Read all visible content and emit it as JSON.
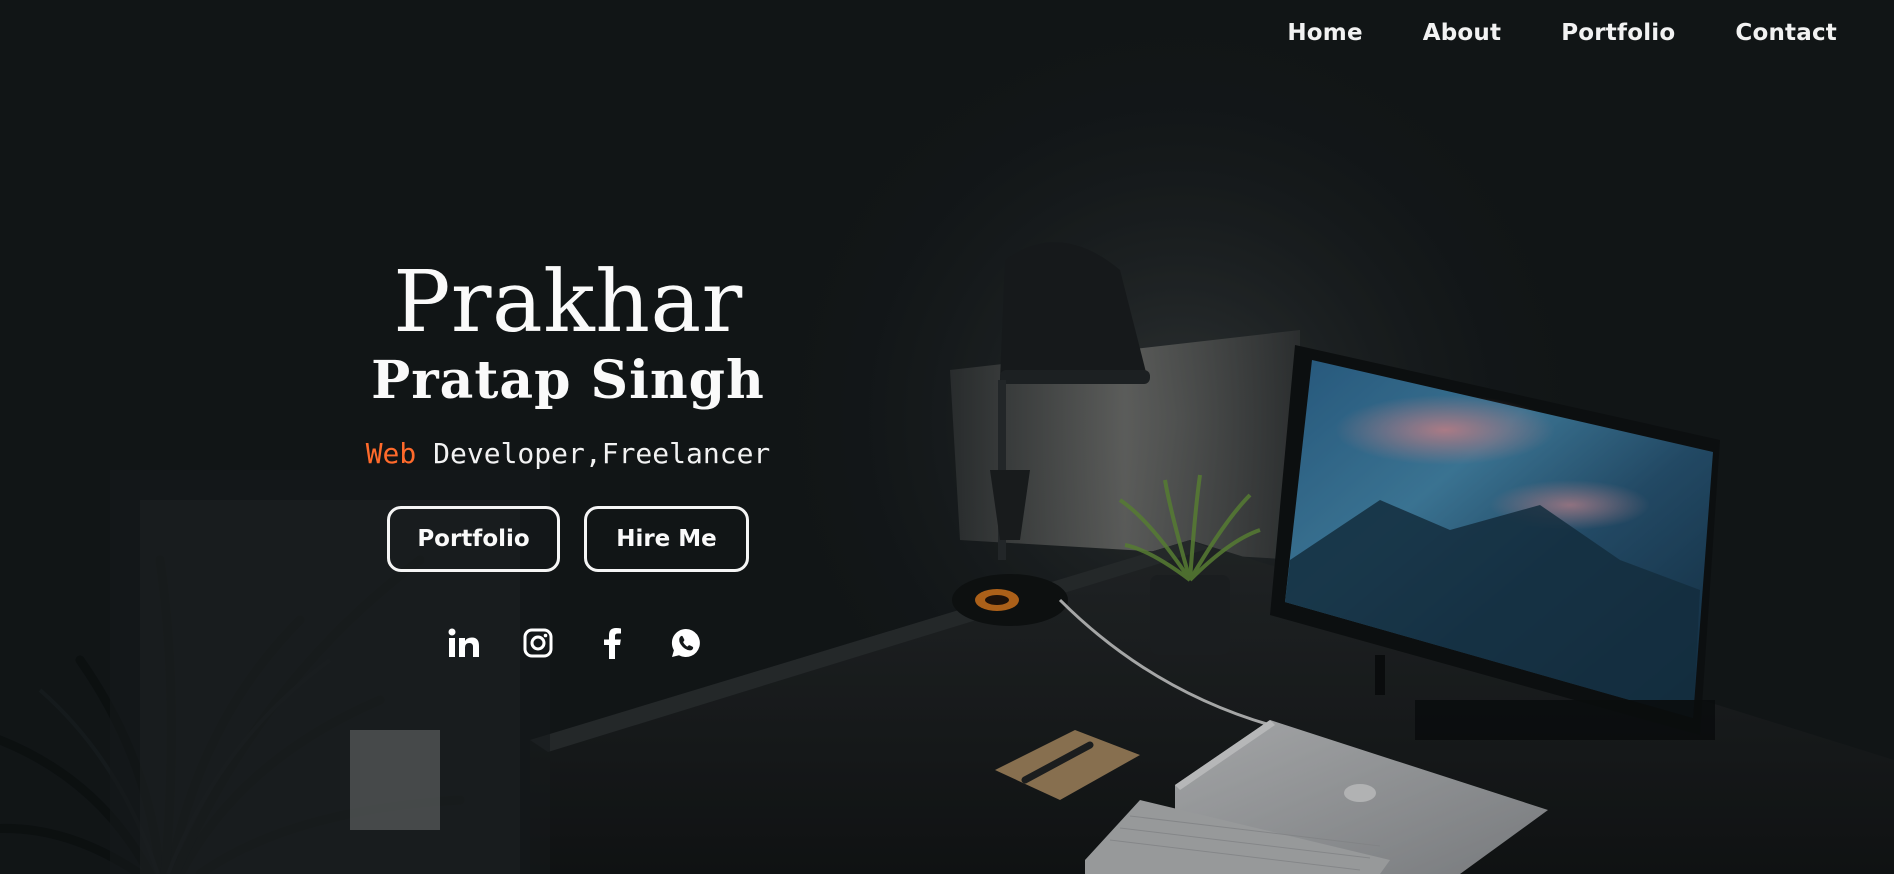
{
  "nav": {
    "items": [
      {
        "label": "Home"
      },
      {
        "label": "About"
      },
      {
        "label": "Portfolio"
      },
      {
        "label": "Contact"
      }
    ]
  },
  "hero": {
    "first_name": "Prakhar",
    "last_name": "Pratap Singh",
    "tagline_accent": "Web",
    "tagline_rest": " Developer,Freelancer",
    "buttons": {
      "portfolio": "Portfolio",
      "hire": "Hire Me"
    }
  },
  "social": {
    "icons": [
      "linkedin-icon",
      "instagram-icon",
      "facebook-icon",
      "whatsapp-icon"
    ]
  },
  "colors": {
    "accent": "#ff6a2b",
    "background": "#121618",
    "text": "#ffffff"
  }
}
